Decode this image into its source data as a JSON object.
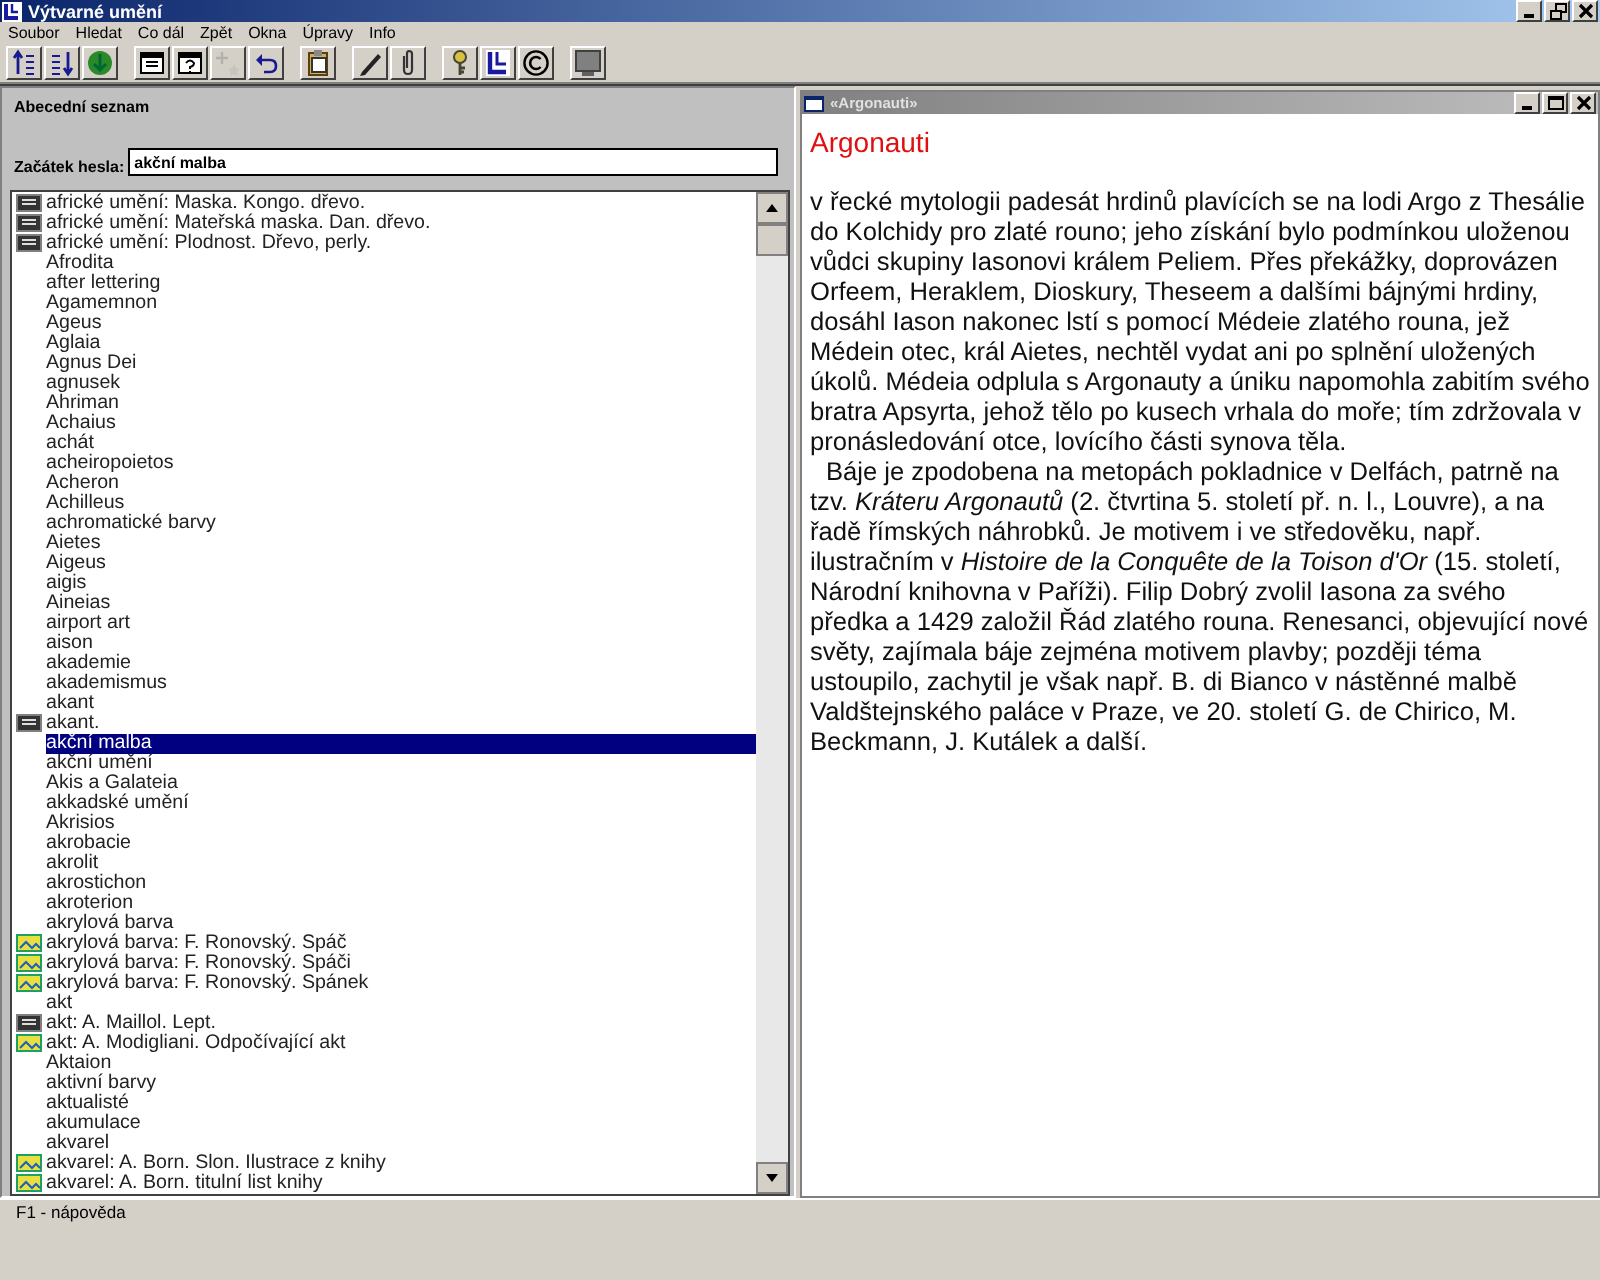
{
  "window": {
    "title": "Výtvarné umění"
  },
  "menu": [
    "Soubor",
    "Hledat",
    "Co dál",
    "Zpět",
    "Okna",
    "Úpravy",
    "Info"
  ],
  "toolbar": [
    [
      {
        "kind": "sort-up",
        "disabled": false
      },
      {
        "kind": "sort-down",
        "disabled": false
      },
      {
        "kind": "go",
        "disabled": false
      }
    ],
    [
      {
        "kind": "window",
        "disabled": false
      },
      {
        "kind": "help-window",
        "disabled": false
      },
      {
        "kind": "star",
        "disabled": true
      },
      {
        "kind": "undo",
        "disabled": false
      }
    ],
    [
      {
        "kind": "clipboard",
        "disabled": false
      }
    ],
    [
      {
        "kind": "pen",
        "disabled": false
      },
      {
        "kind": "paperclip",
        "disabled": false
      }
    ],
    [
      {
        "kind": "key",
        "disabled": false
      },
      {
        "kind": "logo",
        "disabled": false
      },
      {
        "kind": "copyright",
        "disabled": false
      }
    ],
    [
      {
        "kind": "monitor",
        "disabled": false
      }
    ]
  ],
  "index": {
    "heading": "Abecední seznam",
    "search": {
      "label": "Začátek hesla:",
      "value": "akční malba"
    },
    "items": [
      {
        "text": "africké umění: Maska. Kongo. dřevo.",
        "kind": "print",
        "selected": false
      },
      {
        "text": "africké umění: Mateřská maska. Dan. dřevo.",
        "kind": "print",
        "selected": false
      },
      {
        "text": "africké umění: Plodnost. Dřevo, perly.",
        "kind": "print",
        "selected": false
      },
      {
        "text": "Afrodita",
        "kind": "plain",
        "selected": false
      },
      {
        "text": "after lettering",
        "kind": "plain",
        "selected": false
      },
      {
        "text": "Agamemnon",
        "kind": "plain",
        "selected": false
      },
      {
        "text": "Ageus",
        "kind": "plain",
        "selected": false
      },
      {
        "text": "Aglaia",
        "kind": "plain",
        "selected": false
      },
      {
        "text": "Agnus Dei",
        "kind": "plain",
        "selected": false
      },
      {
        "text": "agnusek",
        "kind": "plain",
        "selected": false
      },
      {
        "text": "Ahriman",
        "kind": "plain",
        "selected": false
      },
      {
        "text": "Achaius",
        "kind": "plain",
        "selected": false
      },
      {
        "text": "achát",
        "kind": "plain",
        "selected": false
      },
      {
        "text": "acheiropoietos",
        "kind": "plain",
        "selected": false
      },
      {
        "text": "Acheron",
        "kind": "plain",
        "selected": false
      },
      {
        "text": "Achilleus",
        "kind": "plain",
        "selected": false
      },
      {
        "text": "achromatické barvy",
        "kind": "plain",
        "selected": false
      },
      {
        "text": "Aietes",
        "kind": "plain",
        "selected": false
      },
      {
        "text": "Aigeus",
        "kind": "plain",
        "selected": false
      },
      {
        "text": "aigis",
        "kind": "plain",
        "selected": false
      },
      {
        "text": "Aineias",
        "kind": "plain",
        "selected": false
      },
      {
        "text": "airport art",
        "kind": "plain",
        "selected": false
      },
      {
        "text": "aison",
        "kind": "plain",
        "selected": false
      },
      {
        "text": "akademie",
        "kind": "plain",
        "selected": false
      },
      {
        "text": "akademismus",
        "kind": "plain",
        "selected": false
      },
      {
        "text": "akant",
        "kind": "plain",
        "selected": false
      },
      {
        "text": "akant.",
        "kind": "print",
        "selected": false
      },
      {
        "text": "akční malba",
        "kind": "plain",
        "selected": true
      },
      {
        "text": "akční umění",
        "kind": "plain",
        "selected": false
      },
      {
        "text": "Akis a Galateia",
        "kind": "plain",
        "selected": false
      },
      {
        "text": "akkadské umění",
        "kind": "plain",
        "selected": false
      },
      {
        "text": "Akrisios",
        "kind": "plain",
        "selected": false
      },
      {
        "text": "akrobacie",
        "kind": "plain",
        "selected": false
      },
      {
        "text": "akrolit",
        "kind": "plain",
        "selected": false
      },
      {
        "text": "akrostichon",
        "kind": "plain",
        "selected": false
      },
      {
        "text": "akroterion",
        "kind": "plain",
        "selected": false
      },
      {
        "text": "akrylová barva",
        "kind": "plain",
        "selected": false
      },
      {
        "text": "akrylová barva: F. Ronovský. Spáč",
        "kind": "image",
        "selected": false
      },
      {
        "text": "akrylová barva: F. Ronovský. Spáči",
        "kind": "image",
        "selected": false
      },
      {
        "text": "akrylová barva: F. Ronovský. Spánek",
        "kind": "image",
        "selected": false
      },
      {
        "text": "akt",
        "kind": "plain",
        "selected": false
      },
      {
        "text": "akt: A. Maillol. Lept.",
        "kind": "print",
        "selected": false
      },
      {
        "text": "akt: A. Modigliani. Odpočívající akt",
        "kind": "image",
        "selected": false
      },
      {
        "text": "Aktaion",
        "kind": "plain",
        "selected": false
      },
      {
        "text": "aktivní barvy",
        "kind": "plain",
        "selected": false
      },
      {
        "text": "aktualisté",
        "kind": "plain",
        "selected": false
      },
      {
        "text": "akumulace",
        "kind": "plain",
        "selected": false
      },
      {
        "text": "akvarel",
        "kind": "plain",
        "selected": false
      },
      {
        "text": "akvarel: A. Born. Slon. Ilustrace z knihy",
        "kind": "image",
        "selected": false
      },
      {
        "text": "akvarel: A. Born. titulní list knihy",
        "kind": "image",
        "selected": false
      }
    ]
  },
  "article": {
    "window_title": "«Argonauti»",
    "heading": "Argonauti",
    "paragraphs": [
      "v řecké mytologii padesát hrdinů plavících se na lodi Argo z Thesálie do Kolchidy pro zlaté rouno; jeho získání bylo podmínkou uloženou vůdci skupiny Iasonovi králem Peliem. Přes překážky, doprovázen Orfeem, Heraklem, Dioskury, Theseem a dalšími bájnými hrdiny, dosáhl Iason nakonec lstí s pomocí Médeie zlatého rouna, jež Médein otec, král Aietes, nechtěl vydat ani po splnění uložených úkolů. Médeia odplula s Argonauty a úniku napomohla zabitím svého bratra Apsyrta, jehož tělo po kusech vrhala do moře; tím zdržovala v pronásledování otce, lovícího části synova těla.",
      "Báje je zpodobena na metopách pokladnice v Delfách, patrně na tzv. *Kráteru Argonautů*  (2. čtvrtina 5. století př. n. l., Louvre), a na řadě římských náhrobků. Je motivem i ve středověku, např. ilustračním v *Histoire de la Conquête de la Toison d'Or*  (15. století, Národní knihovna v Paříži). Filip Dobrý zvolil Iasona za svého předka a 1429 založil Řád zlatého rouna. Renesanci, objevující nové světy, zajímala báje zejména motivem plavby; později téma ustoupilo, zachytil je však např. B. di Bianco v nástěnné malbě Valdštejnského paláce v Praze, ve 20. století G. de Chirico, M. Beckmann, J. Kutálek a další."
    ]
  },
  "status_bar": "F1 - nápověda"
}
